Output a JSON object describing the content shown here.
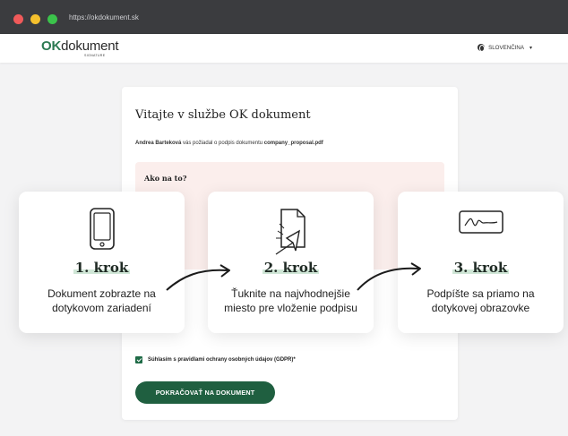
{
  "browser": {
    "url": "https://okdokument.sk"
  },
  "header": {
    "logo_ok": "OK",
    "logo_text": "dokument",
    "logo_sub": "SIGNATURE",
    "language": "SLOVENČINA"
  },
  "main": {
    "title": "Vitajte v službe OK dokument",
    "requester": "Andrea Barteková",
    "request_text": " vás požiadal o podpis dokumentu ",
    "document": "company_proposal.pdf",
    "howto_title": "Ako na to?"
  },
  "steps": [
    {
      "title": "1. krok",
      "description": "Dokument zobrazte na dotykovom zariadení",
      "icon": "phone-icon"
    },
    {
      "title": "2. krok",
      "description": "Ťuknite na najvhodnejšie miesto pre vloženie podpisu",
      "icon": "tap-document-icon"
    },
    {
      "title": "3. krok",
      "description": "Podpíšte sa priamo na dotykovej obrazovke",
      "icon": "signature-screen-icon"
    }
  ],
  "consent": {
    "label": "Súhlasím s pravidlami ochrany osobných údajov (GDPR)*",
    "checked": true
  },
  "cta": {
    "label": "POKRAČOVAŤ NA DOKUMENT"
  },
  "colors": {
    "brand": "#1f5f40",
    "highlight": "#cfe6d6",
    "howto_bg": "#fbeeec"
  }
}
